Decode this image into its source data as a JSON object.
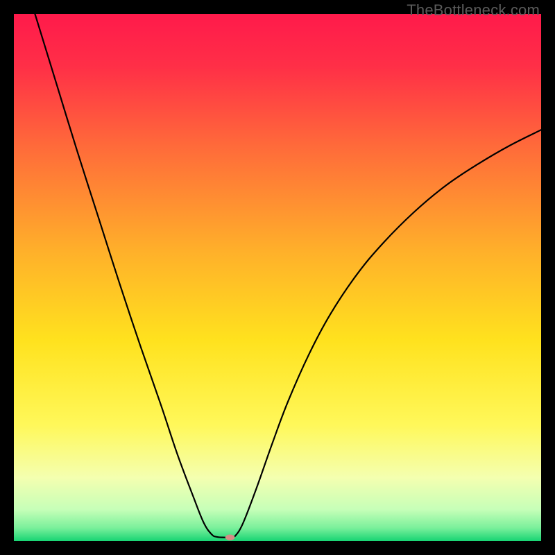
{
  "watermark": "TheBottleneck.com",
  "chart_data": {
    "type": "line",
    "title": "",
    "xlabel": "",
    "ylabel": "",
    "xlim": [
      0,
      100
    ],
    "ylim": [
      0,
      100
    ],
    "grid": false,
    "background_gradient": [
      {
        "pos": 0.0,
        "color": "#ff1a4b"
      },
      {
        "pos": 0.1,
        "color": "#ff2f47"
      },
      {
        "pos": 0.25,
        "color": "#ff6a3a"
      },
      {
        "pos": 0.45,
        "color": "#ffb02a"
      },
      {
        "pos": 0.62,
        "color": "#ffe21e"
      },
      {
        "pos": 0.78,
        "color": "#fff85a"
      },
      {
        "pos": 0.88,
        "color": "#f4ffb0"
      },
      {
        "pos": 0.94,
        "color": "#c6ffb8"
      },
      {
        "pos": 0.975,
        "color": "#7af09b"
      },
      {
        "pos": 1.0,
        "color": "#17d473"
      }
    ],
    "series": [
      {
        "name": "bottleneck-curve",
        "color": "#000000",
        "width": 2.2,
        "data": [
          {
            "x": 4.0,
            "y": 100.0
          },
          {
            "x": 8.0,
            "y": 87.0
          },
          {
            "x": 12.0,
            "y": 74.0
          },
          {
            "x": 16.0,
            "y": 61.5
          },
          {
            "x": 20.0,
            "y": 49.0
          },
          {
            "x": 24.0,
            "y": 37.0
          },
          {
            "x": 28.0,
            "y": 25.5
          },
          {
            "x": 31.0,
            "y": 16.5
          },
          {
            "x": 34.0,
            "y": 8.5
          },
          {
            "x": 36.0,
            "y": 3.5
          },
          {
            "x": 37.5,
            "y": 1.3
          },
          {
            "x": 38.5,
            "y": 0.8
          },
          {
            "x": 40.0,
            "y": 0.7
          },
          {
            "x": 41.0,
            "y": 0.7
          },
          {
            "x": 42.0,
            "y": 1.0
          },
          {
            "x": 43.5,
            "y": 3.5
          },
          {
            "x": 46.0,
            "y": 10.0
          },
          {
            "x": 49.0,
            "y": 18.5
          },
          {
            "x": 52.0,
            "y": 26.5
          },
          {
            "x": 56.0,
            "y": 35.5
          },
          {
            "x": 60.0,
            "y": 43.0
          },
          {
            "x": 65.0,
            "y": 50.5
          },
          {
            "x": 70.0,
            "y": 56.5
          },
          {
            "x": 76.0,
            "y": 62.5
          },
          {
            "x": 82.0,
            "y": 67.5
          },
          {
            "x": 88.0,
            "y": 71.5
          },
          {
            "x": 94.0,
            "y": 75.0
          },
          {
            "x": 100.0,
            "y": 78.0
          }
        ]
      }
    ],
    "marker": {
      "x": 41.0,
      "y": 0.7,
      "rx": 0.9,
      "ry": 0.55,
      "color": "#d58d86"
    }
  }
}
